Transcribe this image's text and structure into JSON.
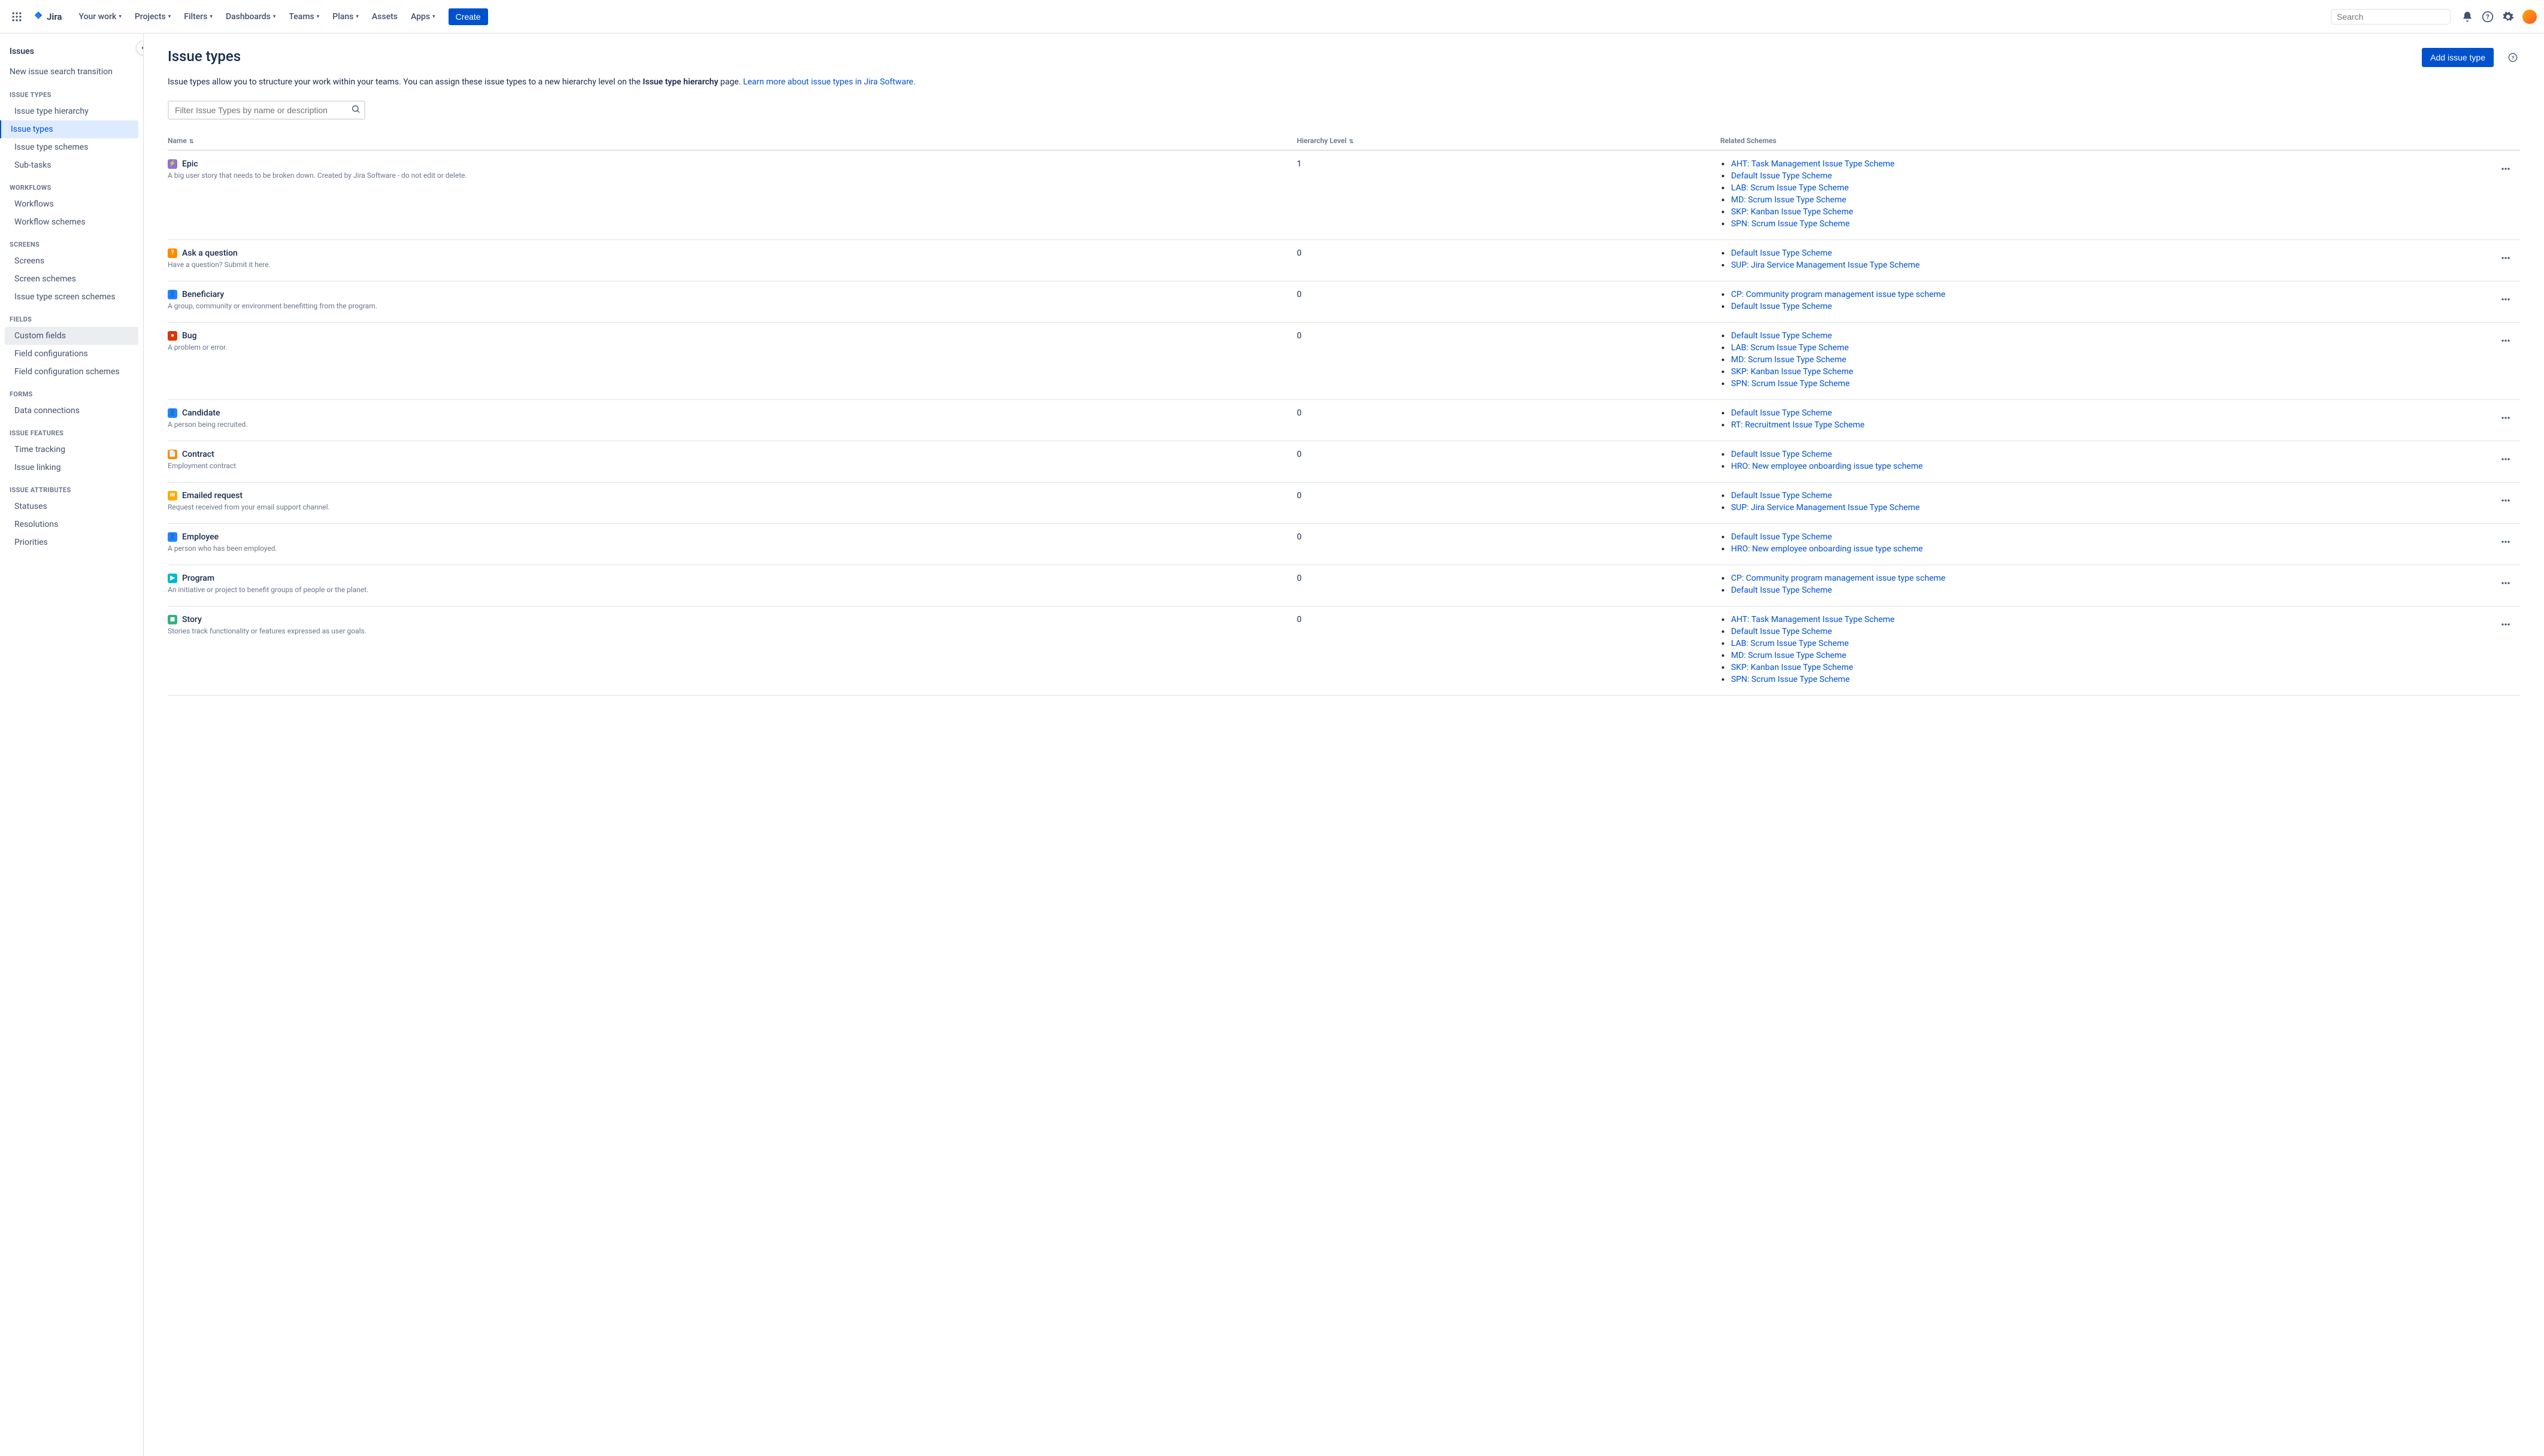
{
  "nav": {
    "logo": "Jira",
    "items": [
      "Your work",
      "Projects",
      "Filters",
      "Dashboards",
      "Teams",
      "Plans",
      "Assets",
      "Apps"
    ],
    "items_chev": [
      true,
      true,
      true,
      true,
      true,
      true,
      false,
      true
    ],
    "create": "Create",
    "search_placeholder": "Search"
  },
  "sidebar": {
    "title": "Issues",
    "major_link": "New issue search transition",
    "sections": [
      {
        "heading": "Issue Types",
        "items": [
          "Issue type hierarchy",
          "Issue types",
          "Issue type schemes",
          "Sub-tasks"
        ],
        "active_index": 1
      },
      {
        "heading": "Workflows",
        "items": [
          "Workflows",
          "Workflow schemes"
        ]
      },
      {
        "heading": "Screens",
        "items": [
          "Screens",
          "Screen schemes",
          "Issue type screen schemes"
        ]
      },
      {
        "heading": "Fields",
        "items": [
          "Custom fields",
          "Field configurations",
          "Field configuration schemes"
        ],
        "hover_index": 0
      },
      {
        "heading": "Forms",
        "items": [
          "Data connections"
        ]
      },
      {
        "heading": "Issue Features",
        "items": [
          "Time tracking",
          "Issue linking"
        ]
      },
      {
        "heading": "Issue Attributes",
        "items": [
          "Statuses",
          "Resolutions",
          "Priorities"
        ]
      }
    ]
  },
  "page": {
    "title": "Issue types",
    "add_button": "Add issue type",
    "intro_before": "Issue types allow you to structure your work within your teams. You can assign these issue types to a new hierarchy level on the ",
    "intro_bold": "Issue type hierarchy",
    "intro_after": " page. ",
    "intro_link": "Learn more about issue types in Jira Software.",
    "filter_placeholder": "Filter Issue Types by name or description",
    "columns": {
      "name": "Name",
      "hier": "Hierarchy Level",
      "schemes": "Related Schemes"
    }
  },
  "issue_types": [
    {
      "icon_color": "#8777D9",
      "icon_glyph": "⚡",
      "name": "Epic",
      "desc": "A big user story that needs to be broken down. Created by Jira Software - do not edit or delete.",
      "hier": "1",
      "schemes": [
        "AHT: Task Management Issue Type Scheme",
        "Default Issue Type Scheme",
        "LAB: Scrum Issue Type Scheme",
        "MD: Scrum Issue Type Scheme",
        "SKP: Kanban Issue Type Scheme",
        "SPN: Scrum Issue Type Scheme"
      ]
    },
    {
      "icon_color": "#FF8B00",
      "icon_glyph": "?",
      "name": "Ask a question",
      "desc": "Have a question? Submit it here.",
      "hier": "0",
      "schemes": [
        "Default Issue Type Scheme",
        "SUP: Jira Service Management Issue Type Scheme"
      ]
    },
    {
      "icon_color": "#2684FF",
      "icon_glyph": "👤",
      "name": "Beneficiary",
      "desc": "A group, community or environment benefitting from the program.",
      "hier": "0",
      "schemes": [
        "CP: Community program management issue type scheme",
        "Default Issue Type Scheme"
      ]
    },
    {
      "icon_color": "#DE350B",
      "icon_glyph": "●",
      "name": "Bug",
      "desc": "A problem or error.",
      "hier": "0",
      "schemes": [
        "Default Issue Type Scheme",
        "LAB: Scrum Issue Type Scheme",
        "MD: Scrum Issue Type Scheme",
        "SKP: Kanban Issue Type Scheme",
        "SPN: Scrum Issue Type Scheme"
      ]
    },
    {
      "icon_color": "#2684FF",
      "icon_glyph": "👤",
      "name": "Candidate",
      "desc": "A person being recruited.",
      "hier": "0",
      "schemes": [
        "Default Issue Type Scheme",
        "RT: Recruitment Issue Type Scheme"
      ]
    },
    {
      "icon_color": "#FF8B00",
      "icon_glyph": "📄",
      "name": "Contract",
      "desc": "Employment contract",
      "hier": "0",
      "schemes": [
        "Default Issue Type Scheme",
        "HRO: New employee onboarding issue type scheme"
      ]
    },
    {
      "icon_color": "#FFAB00",
      "icon_glyph": "✉",
      "name": "Emailed request",
      "desc": "Request received from your email support channel.",
      "hier": "0",
      "schemes": [
        "Default Issue Type Scheme",
        "SUP: Jira Service Management Issue Type Scheme"
      ]
    },
    {
      "icon_color": "#2684FF",
      "icon_glyph": "👤",
      "name": "Employee",
      "desc": "A person who has been employed.",
      "hier": "0",
      "schemes": [
        "Default Issue Type Scheme",
        "HRO: New employee onboarding issue type scheme"
      ]
    },
    {
      "icon_color": "#00B8D9",
      "icon_glyph": "▶",
      "name": "Program",
      "desc": "An initiative or project to benefit groups of people or the planet.",
      "hier": "0",
      "schemes": [
        "CP: Community program management issue type scheme",
        "Default Issue Type Scheme"
      ]
    },
    {
      "icon_color": "#36B37E",
      "icon_glyph": "◼",
      "name": "Story",
      "desc": "Stories track functionality or features expressed as user goals.",
      "hier": "0",
      "schemes": [
        "AHT: Task Management Issue Type Scheme",
        "Default Issue Type Scheme",
        "LAB: Scrum Issue Type Scheme",
        "MD: Scrum Issue Type Scheme",
        "SKP: Kanban Issue Type Scheme",
        "SPN: Scrum Issue Type Scheme"
      ]
    }
  ]
}
